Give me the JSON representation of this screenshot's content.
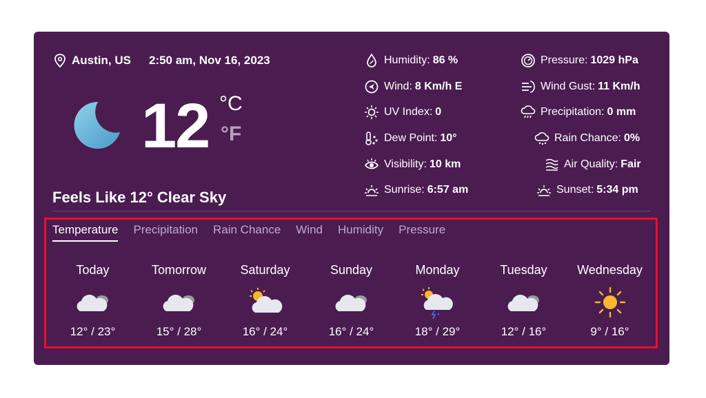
{
  "location": "Austin, US",
  "datetime": "2:50 am, Nov 16, 2023",
  "current": {
    "temperature": "12",
    "unit_c": "°C",
    "unit_f": "°F",
    "feels_like": "Feels Like 12° Clear Sky",
    "icon": "moon-icon"
  },
  "stats_left": [
    {
      "label": "Humidity:",
      "value": "86 %",
      "icon": "humidity-icon"
    },
    {
      "label": "Wind:",
      "value": "8 Km/h E",
      "icon": "wind-icon"
    },
    {
      "label": "UV Index:",
      "value": "0",
      "icon": "uv-index-icon"
    },
    {
      "label": "Dew Point:",
      "value": "10°",
      "icon": "dew-point-icon"
    },
    {
      "label": "Visibility:",
      "value": "10 km",
      "icon": "visibility-icon"
    },
    {
      "label": "Sunrise:",
      "value": "6:57 am",
      "icon": "sunrise-icon"
    }
  ],
  "stats_right": [
    {
      "label": "Pressure:",
      "value": "1029 hPa",
      "icon": "pressure-icon"
    },
    {
      "label": "Wind Gust:",
      "value": "11 Km/h",
      "icon": "wind-gust-icon"
    },
    {
      "label": "Precipitation:",
      "value": "0 mm",
      "icon": "precipitation-icon"
    },
    {
      "label": "Rain Chance:",
      "value": "0%",
      "icon": "rain-chance-icon"
    },
    {
      "label": "Air Quality:",
      "value": "Fair",
      "icon": "air-quality-icon"
    },
    {
      "label": "Sunset:",
      "value": "5:34 pm",
      "icon": "sunset-icon"
    }
  ],
  "tabs": [
    "Temperature",
    "Precipitation",
    "Rain Chance",
    "Wind",
    "Humidity",
    "Pressure"
  ],
  "active_tab": "Temperature",
  "forecast": [
    {
      "day": "Today",
      "range": "12° / 23°",
      "icon": "cloudy-icon"
    },
    {
      "day": "Tomorrow",
      "range": "15° / 28°",
      "icon": "cloudy-icon"
    },
    {
      "day": "Saturday",
      "range": "16° / 24°",
      "icon": "partly-cloudy-icon"
    },
    {
      "day": "Sunday",
      "range": "16° / 24°",
      "icon": "cloudy-icon"
    },
    {
      "day": "Monday",
      "range": "18° / 29°",
      "icon": "thunderstorm-icon"
    },
    {
      "day": "Tuesday",
      "range": "12° / 16°",
      "icon": "cloudy-icon"
    },
    {
      "day": "Wednesday",
      "range": "9° / 16°",
      "icon": "sunny-icon"
    }
  ],
  "colors": {
    "card": "#4a1c50",
    "highlight": "#e8102a",
    "muted_tab": "#c2a8c8"
  }
}
